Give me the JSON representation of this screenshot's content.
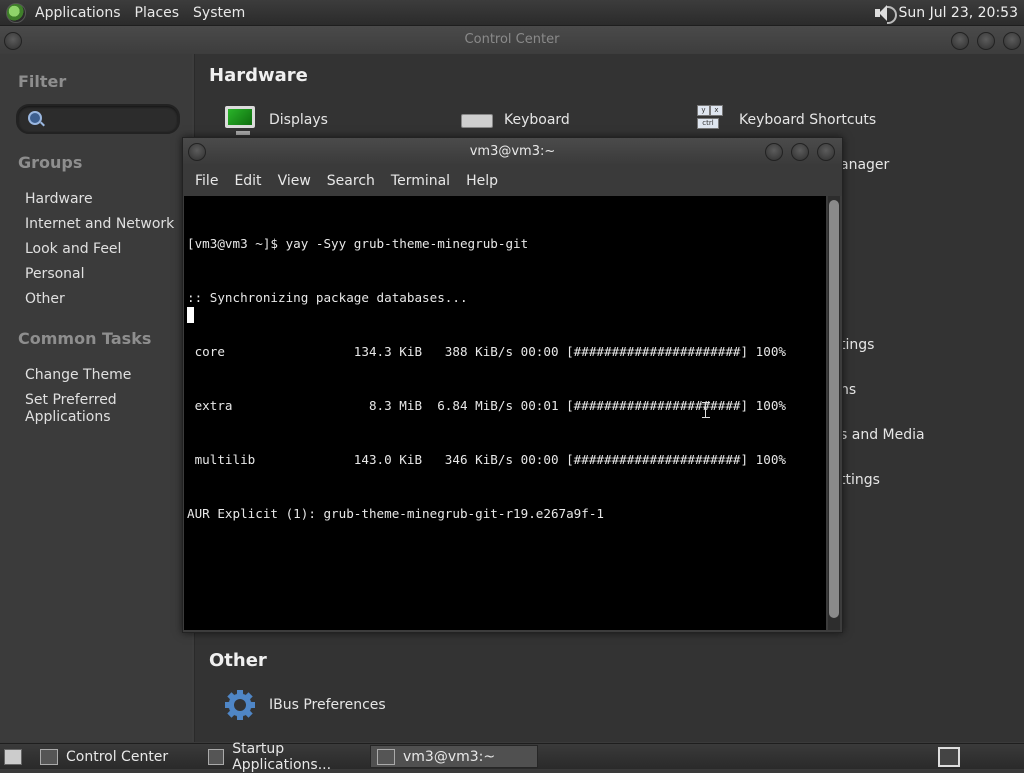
{
  "top_panel": {
    "menus": [
      "Applications",
      "Places",
      "System"
    ],
    "clock": "Sun Jul 23, 20:53",
    "volume_icon": "speaker-icon"
  },
  "control_center": {
    "title": "Control Center",
    "sidebar": {
      "filter_label": "Filter",
      "groups_label": "Groups",
      "groups": [
        "Hardware",
        "Internet and Network",
        "Look and Feel",
        "Personal",
        "Other"
      ],
      "common_tasks_label": "Common Tasks",
      "tasks": [
        "Change Theme",
        "Set Preferred Applications"
      ]
    },
    "main": {
      "hardware_title": "Hardware",
      "hardware_items": [
        "Displays",
        "Keyboard",
        "Keyboard Shortcuts"
      ],
      "partial_items": [
        "anager",
        "tings",
        "ns",
        "s and Media",
        "ttings"
      ],
      "other_title": "Other",
      "other_items": [
        "IBus Preferences"
      ]
    }
  },
  "terminal": {
    "title": "vm3@vm3:~",
    "menus": [
      "File",
      "Edit",
      "View",
      "Search",
      "Terminal",
      "Help"
    ],
    "lines": [
      "[vm3@vm3 ~]$ yay -Syy grub-theme-minegrub-git",
      ":: Synchronizing package databases...",
      " core                 134.3 KiB   388 KiB/s 00:00 [######################] 100%",
      " extra                  8.3 MiB  6.84 MiB/s 00:01 [######################] 100%",
      " multilib             143.0 KiB   346 KiB/s 00:00 [######################] 100%",
      "AUR Explicit (1): grub-theme-minegrub-git-r19.e267a9f-1"
    ]
  },
  "taskbar": {
    "tasks": [
      "Control Center",
      "Startup Applications...",
      "vm3@vm3:~"
    ],
    "active_task": "vm3@vm3:~"
  }
}
